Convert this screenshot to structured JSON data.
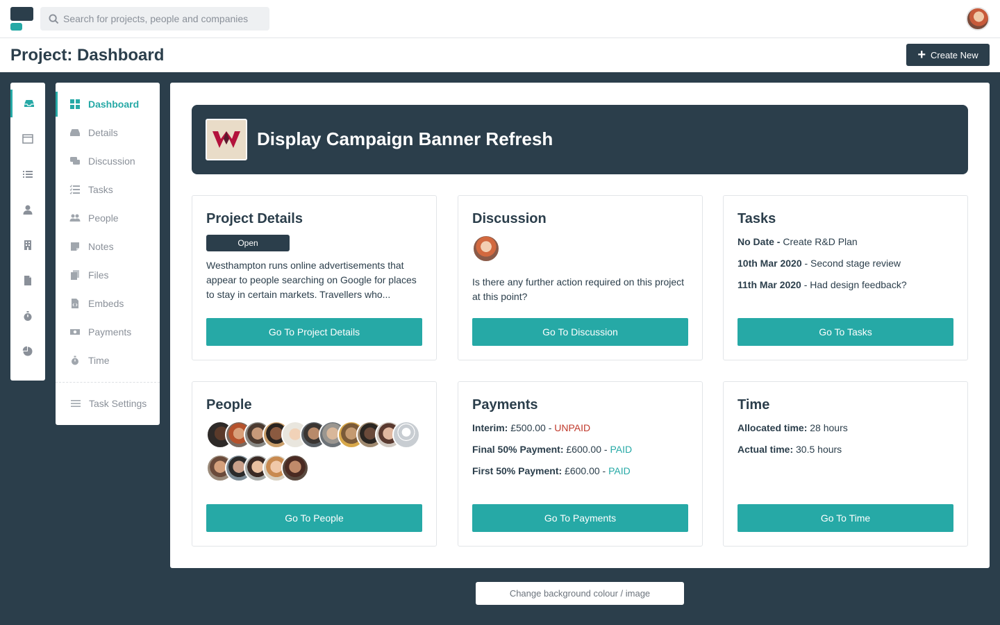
{
  "search": {
    "placeholder": "Search for projects, people and companies"
  },
  "header": {
    "title": "Project: Dashboard",
    "create_label": "Create New"
  },
  "rail": {
    "icons": [
      "inbox-icon",
      "window-icon",
      "list-icon",
      "user-icon",
      "building-icon",
      "file-icon",
      "stopwatch-icon",
      "pie-chart-icon"
    ],
    "active_index": 0
  },
  "subnav": {
    "items": [
      {
        "label": "Dashboard",
        "icon": "grid-icon",
        "active": true
      },
      {
        "label": "Details",
        "icon": "inbox-icon"
      },
      {
        "label": "Discussion",
        "icon": "chat-icon"
      },
      {
        "label": "Tasks",
        "icon": "task-list-icon"
      },
      {
        "label": "People",
        "icon": "users-icon"
      },
      {
        "label": "Notes",
        "icon": "note-icon"
      },
      {
        "label": "Files",
        "icon": "files-icon"
      },
      {
        "label": "Embeds",
        "icon": "code-file-icon"
      },
      {
        "label": "Payments",
        "icon": "money-icon"
      },
      {
        "label": "Time",
        "icon": "stopwatch-icon"
      }
    ],
    "settings_label": "Task Settings"
  },
  "banner": {
    "title": "Display Campaign Banner Refresh"
  },
  "cards": {
    "details": {
      "title": "Project Details",
      "status": "Open",
      "description": "Westhampton runs online advertisements that appear to people searching on Google for places to stay in certain markets. Travellers who...",
      "button": "Go To Project Details"
    },
    "discussion": {
      "title": "Discussion",
      "message": "Is there any further action required on this project at this point?",
      "button": "Go To Discussion"
    },
    "tasks": {
      "title": "Tasks",
      "items": [
        {
          "date": "No Date -",
          "text": " Create R&D Plan"
        },
        {
          "date": "10th Mar 2020",
          "text": " - Second stage review"
        },
        {
          "date": "11th Mar 2020",
          "text": " - Had design feedback?"
        }
      ],
      "button": "Go To Tasks"
    },
    "people": {
      "title": "People",
      "avatar_count": 15,
      "button": "Go To People"
    },
    "payments": {
      "title": "Payments",
      "items": [
        {
          "label": "Interim:",
          "amount": " £500.00 - ",
          "status": "UNPAID"
        },
        {
          "label": "Final 50% Payment:",
          "amount": " £600.00 - ",
          "status": "PAID"
        },
        {
          "label": "First 50% Payment:",
          "amount": " £600.00 - ",
          "status": "PAID"
        }
      ],
      "button": "Go To Payments"
    },
    "time": {
      "title": "Time",
      "allocated_label": "Allocated time:",
      "allocated_value": " 28 hours",
      "actual_label": "Actual time:",
      "actual_value": " 30.5 hours",
      "button": "Go To Time"
    }
  },
  "footer": {
    "background_button": "Change background colour / image"
  },
  "colors": {
    "brand_dark": "#2b3e4b",
    "accent": "#26a9a6",
    "unpaid": "#c0392b"
  }
}
